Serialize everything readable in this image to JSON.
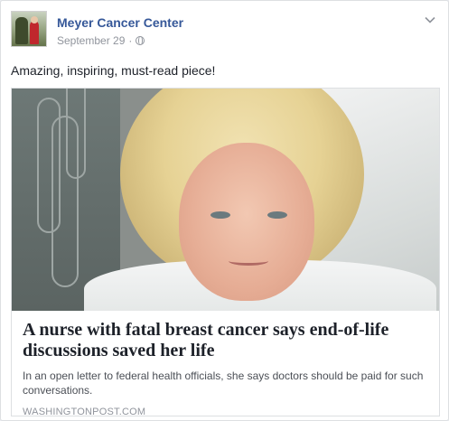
{
  "post": {
    "page_name": "Meyer Cancer Center",
    "date": "September 29",
    "separator": "·",
    "audience_icon": "globe-icon",
    "menu_icon": "chevron-down-icon",
    "text": "Amazing, inspiring, must-read piece!"
  },
  "link": {
    "headline": "A nurse with fatal breast cancer says end-of-life discussions saved her life",
    "summary": "In an open letter to federal health officials, she says doctors should be paid for such conversations.",
    "source": "WASHINGTONPOST.COM"
  },
  "colors": {
    "link_blue": "#365899",
    "meta_gray": "#90949c",
    "text_dark": "#1d2129"
  }
}
